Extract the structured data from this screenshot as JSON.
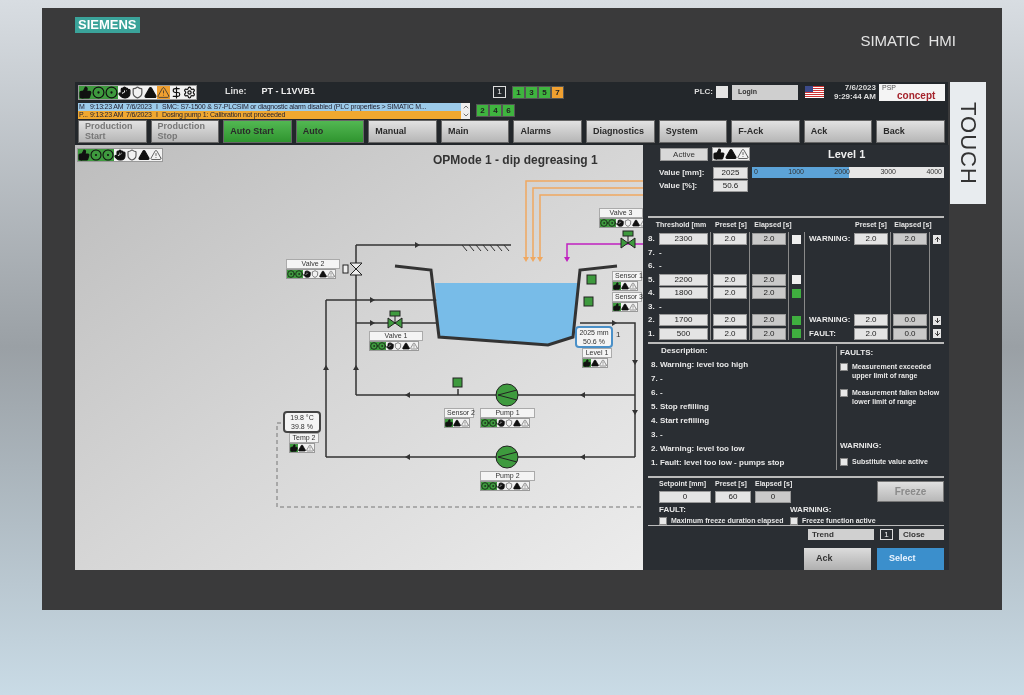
{
  "device": {
    "brand": "SIEMENS",
    "model": "SIMATIC  HMI",
    "touch_label": "TOUCH"
  },
  "header": {
    "line_label": "Line:",
    "line_value": "PT - L1VVB1",
    "screen_number": "1",
    "screen_buttons_top": [
      {
        "label": "1",
        "selected": false
      },
      {
        "label": "3",
        "selected": false
      },
      {
        "label": "5",
        "selected": false
      },
      {
        "label": "7",
        "selected": true
      }
    ],
    "screen_buttons_bottom": [
      {
        "label": "2",
        "selected": false
      },
      {
        "label": "4",
        "selected": false
      },
      {
        "label": "6",
        "selected": false
      }
    ],
    "plc_label": "PLC:",
    "login": "Login",
    "date": "7/6/2023",
    "time": "9:29:44 AM",
    "logo_small": "PSP",
    "logo_main": "concept"
  },
  "alarms": [
    {
      "class": "M",
      "time": "9:13:23 AM",
      "date": "7/6/2023",
      "status": "I",
      "text": "SMC: S7-1500 & S7-PLCSIM or diagnostic alarm disabled (PLC properties > SIMATIC M...",
      "color": "#9ccbea"
    },
    {
      "class": "P...",
      "time": "9:13:23 AM",
      "date": "7/6/2023",
      "status": "I",
      "text": "Dosing pump 1: Calibration not proceeded",
      "color": "#f0a830"
    }
  ],
  "nav": [
    {
      "label": "Production Start",
      "selected": false,
      "disabled": true
    },
    {
      "label": "Production Stop",
      "selected": false,
      "disabled": true
    },
    {
      "label": "Auto Start",
      "selected": true,
      "disabled": false
    },
    {
      "label": "Auto",
      "selected": true,
      "disabled": false
    },
    {
      "label": "Manual",
      "selected": false,
      "disabled": false
    },
    {
      "label": "Main",
      "selected": false,
      "disabled": false
    },
    {
      "label": "Alarms",
      "selected": false,
      "disabled": false
    },
    {
      "label": "Diagnostics",
      "selected": false,
      "disabled": false
    },
    {
      "label": "System",
      "selected": false,
      "disabled": false
    },
    {
      "label": "F-Ack",
      "selected": false,
      "disabled": false
    },
    {
      "label": "Ack",
      "selected": false,
      "disabled": false
    },
    {
      "label": "Back",
      "selected": false,
      "disabled": false
    }
  ],
  "diagram": {
    "title": "OPMode 1 - dip degreasing 1",
    "devices": [
      {
        "name": "Valve 3",
        "kind": "actuator"
      },
      {
        "name": "Valve 2",
        "kind": "actuator"
      },
      {
        "name": "Sensor 1",
        "kind": "sensor"
      },
      {
        "name": "Sensor 3",
        "kind": "sensor"
      },
      {
        "name": "Valve 1",
        "kind": "actuator"
      },
      {
        "name": "Level 1",
        "kind": "sensor"
      },
      {
        "name": "Sensor 2",
        "kind": "sensor"
      },
      {
        "name": "Pump 1",
        "kind": "actuator"
      },
      {
        "name": "Temp 2",
        "kind": "sensor"
      },
      {
        "name": "Pump 2",
        "kind": "actuator"
      }
    ],
    "level_display": {
      "value1": "2025 mm",
      "value2": "50.6  %",
      "index": "1"
    },
    "temp_display": {
      "value1": "19.8  °C",
      "value2": "39.8  %"
    }
  },
  "panel": {
    "status": "Active",
    "title": "Level 1",
    "value_mm_label": "Value [mm]:",
    "value_mm": "2025",
    "value_pct_label": "Value [%]:",
    "value_pct": "50.6",
    "bar": {
      "level": 0.506,
      "ticks": [
        "0",
        "1000",
        "2000",
        "3000",
        "4000"
      ]
    },
    "threshold_columns": [
      "Threshold [mm",
      "Preset [s]",
      "Elapsed [s]"
    ],
    "limit_columns": [
      "Preset [s]",
      "Elapsed [s]"
    ],
    "thresholds": [
      {
        "index": "8.",
        "kind": "set",
        "threshold": "2300",
        "preset": "2.0",
        "elapsed": "2.0",
        "on": false,
        "limit": {
          "label": "WARNING:",
          "preset": "2.0",
          "elapsed": "2.0",
          "kind": "upper"
        }
      },
      {
        "index": "7.",
        "kind": "empty",
        "threshold": "-"
      },
      {
        "index": "6.",
        "kind": "empty",
        "threshold": "-"
      },
      {
        "index": "5.",
        "kind": "set",
        "threshold": "2200",
        "preset": "2.0",
        "elapsed": "2.0",
        "on": false
      },
      {
        "index": "4.",
        "kind": "set",
        "threshold": "1800",
        "preset": "2.0",
        "elapsed": "2.0",
        "on": true
      },
      {
        "index": "3.",
        "kind": "empty",
        "threshold": "-"
      },
      {
        "index": "2.",
        "kind": "set",
        "threshold": "1700",
        "preset": "2.0",
        "elapsed": "2.0",
        "on": true,
        "limit": {
          "label": "WARNING:",
          "preset": "2.0",
          "elapsed": "0.0",
          "kind": "lower"
        }
      },
      {
        "index": "1.",
        "kind": "set",
        "threshold": "500",
        "preset": "2.0",
        "elapsed": "2.0",
        "on": true,
        "limit": {
          "label": "FAULT:",
          "preset": "2.0",
          "elapsed": "0.0",
          "kind": "lower"
        }
      }
    ],
    "description_title": "Description:",
    "descriptions": [
      "8. Warning: level too high",
      "7. -",
      "6. -",
      "5. Stop refilling",
      "4. Start refilling",
      "3. -",
      "2. Warning: level too low",
      "1. Fault: level too low - pumps stop"
    ],
    "faults_title": "FAULTS:",
    "faults": [
      {
        "label": "Measurement exceeded upper limit of range",
        "checked": false
      },
      {
        "label": "Measurement fallen below lower limit of range",
        "checked": false
      }
    ],
    "warning_title": "WARNING:",
    "warnings": [
      {
        "label": "Substitute value active",
        "checked": false
      }
    ],
    "freeze": {
      "columns": [
        "Setpoint [mm]",
        "Preset [s]",
        "Elapsed [s]"
      ],
      "values": [
        "0",
        "60",
        "0"
      ],
      "button": "Freeze",
      "disabled": true,
      "fault_title": "FAULT:",
      "fault_check": {
        "label": "Maximum freeze duration elapsed",
        "checked": false
      },
      "warning_title": "WARNING:",
      "warning_check": {
        "label": "Freeze function active",
        "checked": false
      }
    },
    "footer": {
      "trend": "Trend",
      "screen_number": "1",
      "close": "Close",
      "actions": [
        {
          "label": "Ack",
          "selected": false
        },
        {
          "label": "Select",
          "selected": true
        }
      ]
    }
  }
}
